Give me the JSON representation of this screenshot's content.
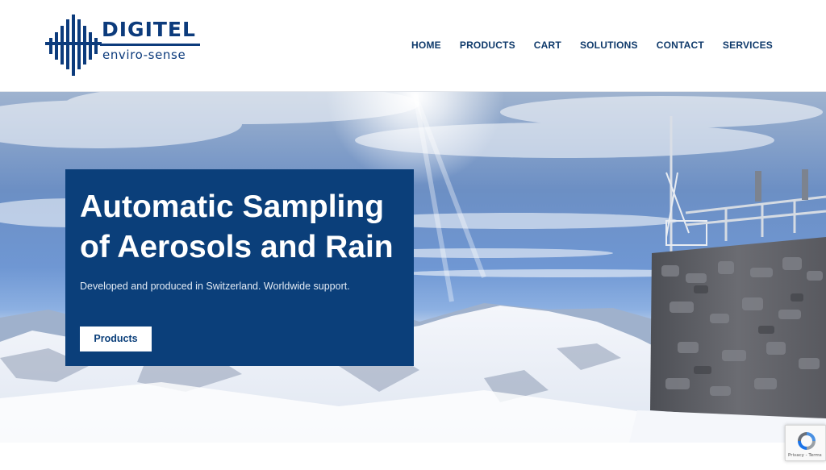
{
  "brand": {
    "name": "DIGITEL",
    "tagline": "enviro-sense",
    "color": "#0c3b7c"
  },
  "nav": {
    "items": [
      {
        "label": "HOME"
      },
      {
        "label": "PRODUCTS"
      },
      {
        "label": "CART"
      },
      {
        "label": "SOLUTIONS"
      },
      {
        "label": "CONTACT"
      },
      {
        "label": "SERVICES"
      }
    ]
  },
  "hero": {
    "title": "Automatic Sampling of Aerosols and Rain",
    "subtitle": "Developed and produced in Switzerland. Worldwide support.",
    "button_label": "Products",
    "box_color": "#0b3f7a",
    "background": "snow-covered mountains with sampling station on stone building"
  },
  "recaptcha": {
    "text": "Privacy - Terms",
    "icon": "recaptcha-icon"
  }
}
